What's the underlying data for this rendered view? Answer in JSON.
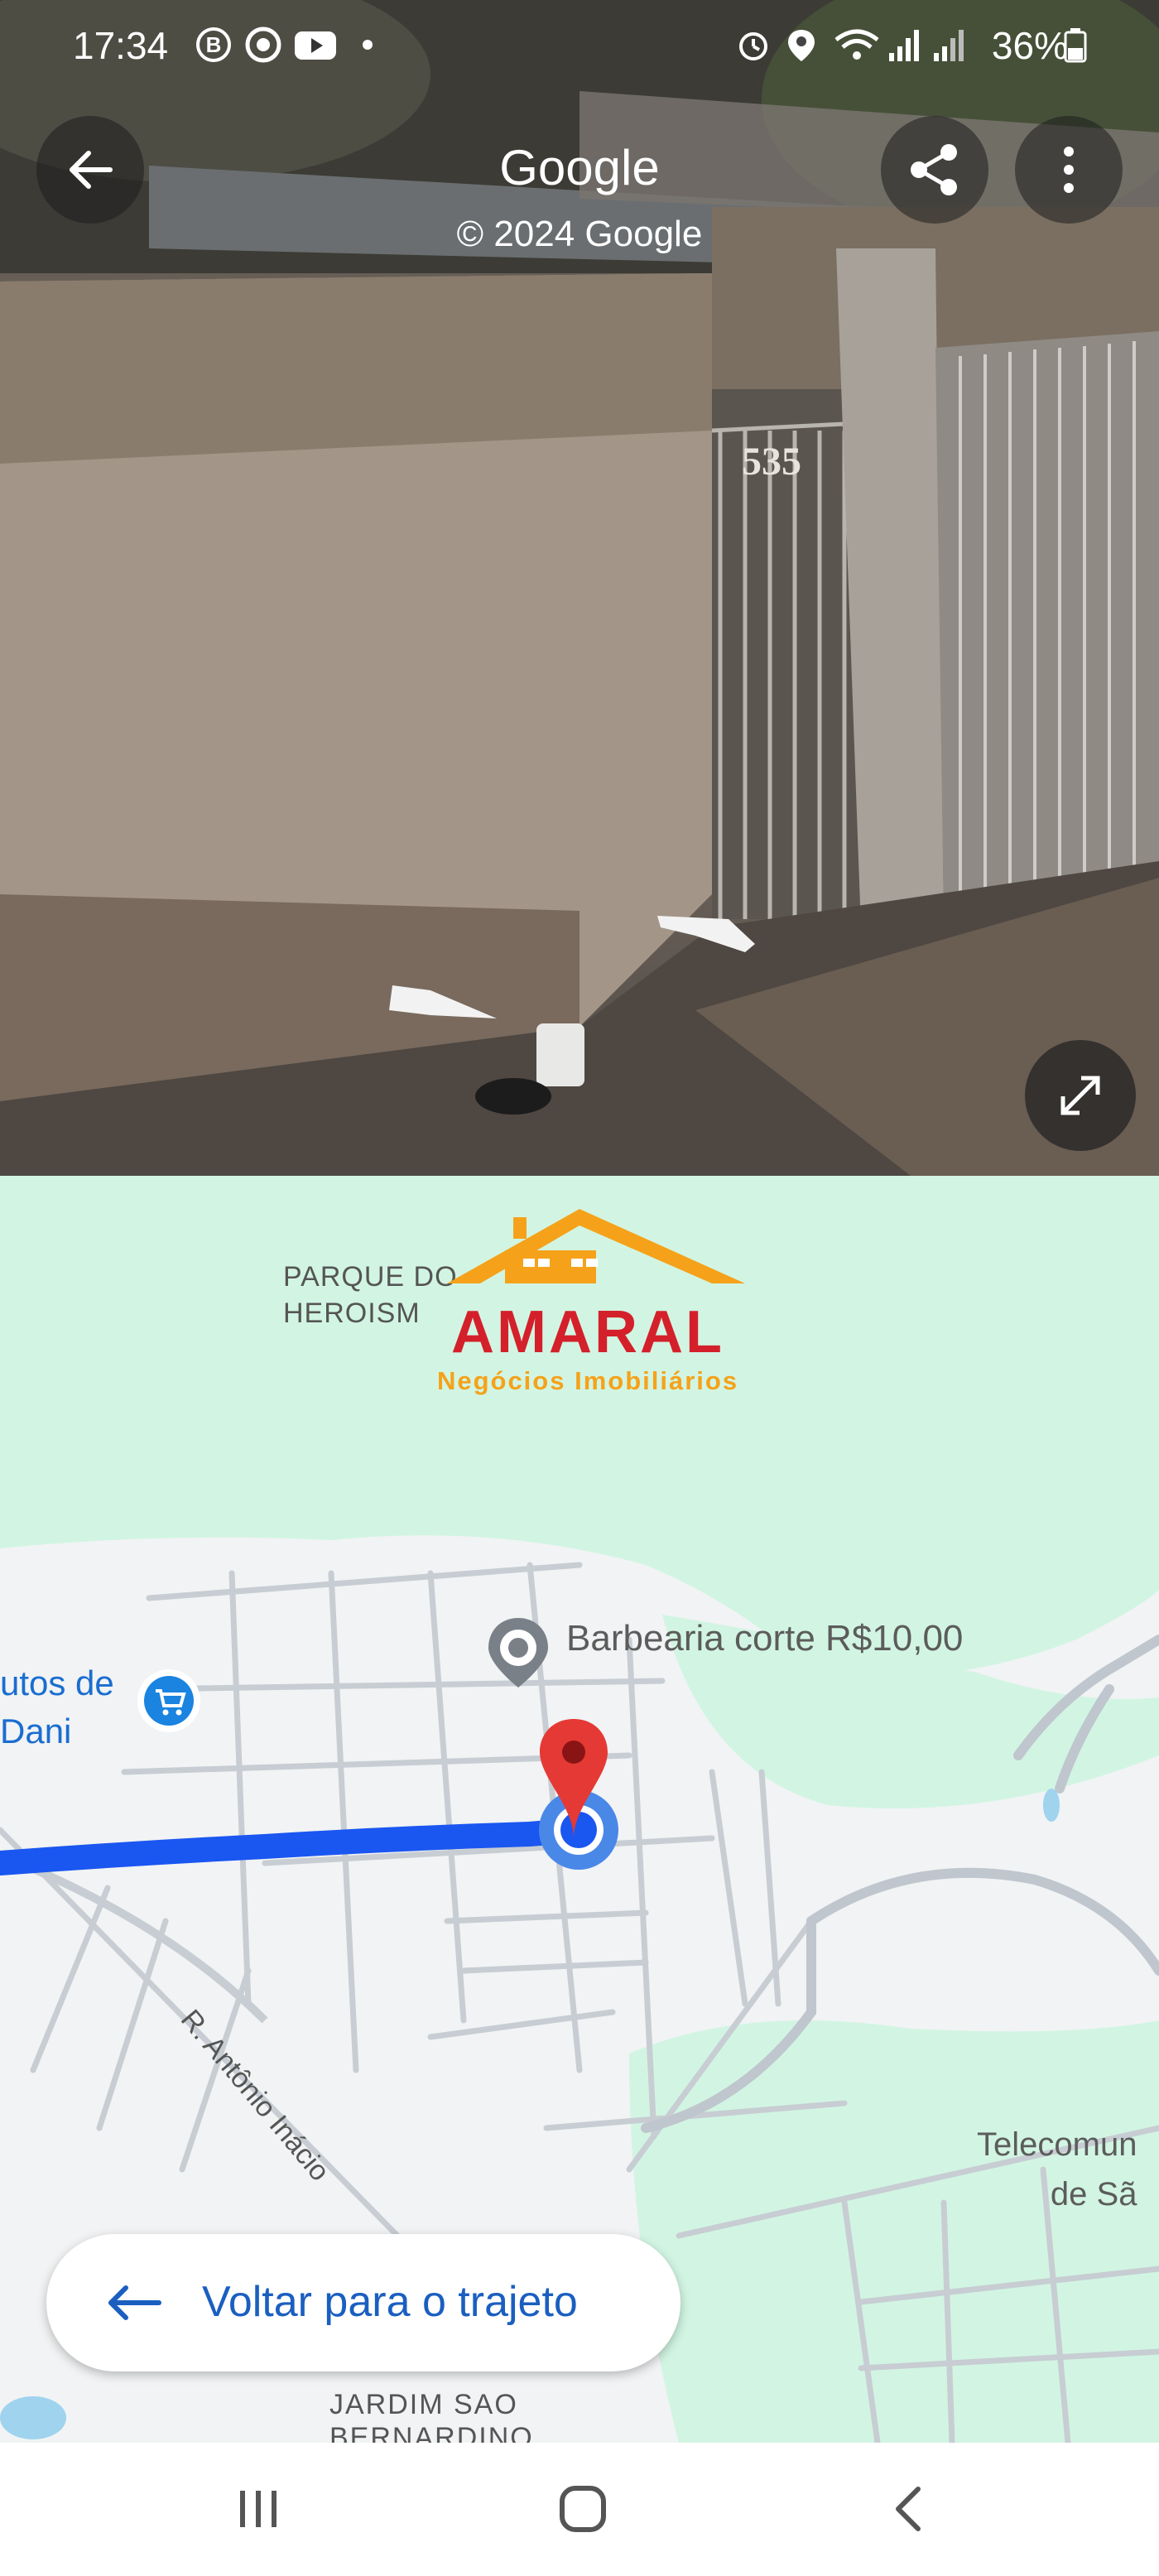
{
  "status_bar": {
    "time": "17:34",
    "battery": "36%",
    "left_icons": [
      "b-icon",
      "chrome-icon",
      "youtube-icon",
      "dot-icon"
    ],
    "right_icons": [
      "alarm-icon",
      "location-icon",
      "wifi-icon",
      "signal-icon",
      "signal-icon",
      "battery-icon"
    ]
  },
  "street_view": {
    "title": "Google",
    "copyright": "© 2024 Google",
    "house_number": "535"
  },
  "map": {
    "labels": {
      "parque_line1": "PARQUE DO",
      "parque_line2": "HEROISM",
      "barbearia": "Barbearia corte R$10,00",
      "frutos_line1": "utos de",
      "frutos_line2": "Dani",
      "street": "R. Antônio Inácio",
      "telecom_line1": "Telecomun",
      "telecom_line2": "de Sã",
      "jardim_line1": "JARDIM SAO",
      "jardim_line2": "BERNARDINO"
    },
    "route_color": "#1a56f0",
    "pin_color": "#e53935"
  },
  "watermark": {
    "brand": "AMARAL",
    "tagline": "Negócios Imobiliários"
  },
  "return_button": {
    "label": "Voltar para o trajeto"
  },
  "nav_bar": {
    "buttons": [
      "recent-apps",
      "home",
      "back"
    ]
  }
}
